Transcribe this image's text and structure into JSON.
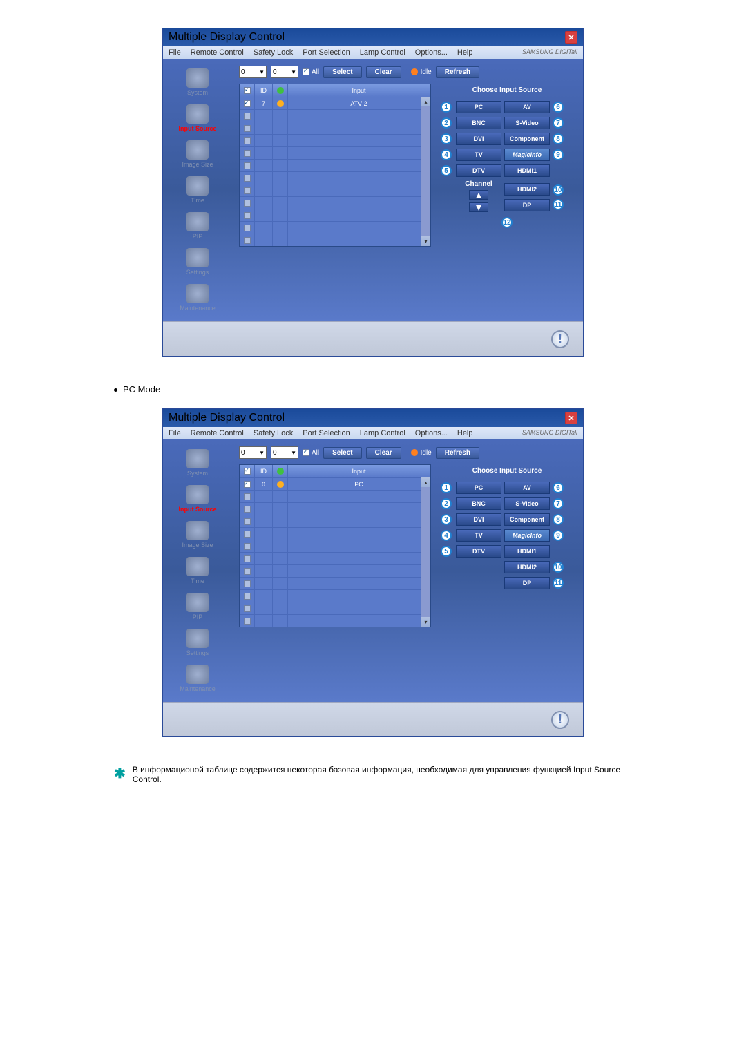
{
  "window": {
    "title": "Multiple Display Control",
    "brand": "SAMSUNG DIGITall"
  },
  "menu": {
    "file": "File",
    "remote": "Remote Control",
    "safety": "Safety Lock",
    "port": "Port Selection",
    "lamp": "Lamp Control",
    "options": "Options...",
    "help": "Help"
  },
  "sidebar": {
    "system": "System",
    "input_source": "Input Source",
    "image_size": "Image Size",
    "time": "Time",
    "pip": "PIP",
    "settings": "Settings",
    "maintenance": "Maintenance"
  },
  "toolbar": {
    "dd1": "0",
    "dd2": "0",
    "all": "All",
    "select": "Select",
    "clear": "Clear",
    "idle": "Idle",
    "refresh": "Refresh"
  },
  "table": {
    "id_header": "ID",
    "input_header": "Input",
    "row1_id": "7",
    "row1_input_atv": "ATV 2",
    "row1_id_pc": "0",
    "row1_input_pc": "PC"
  },
  "panel": {
    "title": "Choose Input Source",
    "pc": "PC",
    "av": "AV",
    "bnc": "BNC",
    "svideo": "S-Video",
    "dvi": "DVI",
    "component": "Component",
    "tv": "TV",
    "magicinfo": "MagicInfo",
    "dtv": "DTV",
    "hdmi1": "HDMI1",
    "hdmi2": "HDMI2",
    "dp": "DP"
  },
  "callouts": {
    "c1": "1",
    "c2": "2",
    "c3": "3",
    "c4": "4",
    "c5": "5",
    "c6": "6",
    "c7": "7",
    "c8": "8",
    "c9": "9",
    "c10": "10",
    "c11": "11",
    "c12": "12"
  },
  "channel": "Channel",
  "pc_mode_label": "PC Mode",
  "note_text": "В информационой таблице содержится некоторая базовая информация, необходимая для управления функцией Input Source Control.",
  "chart_data": null
}
